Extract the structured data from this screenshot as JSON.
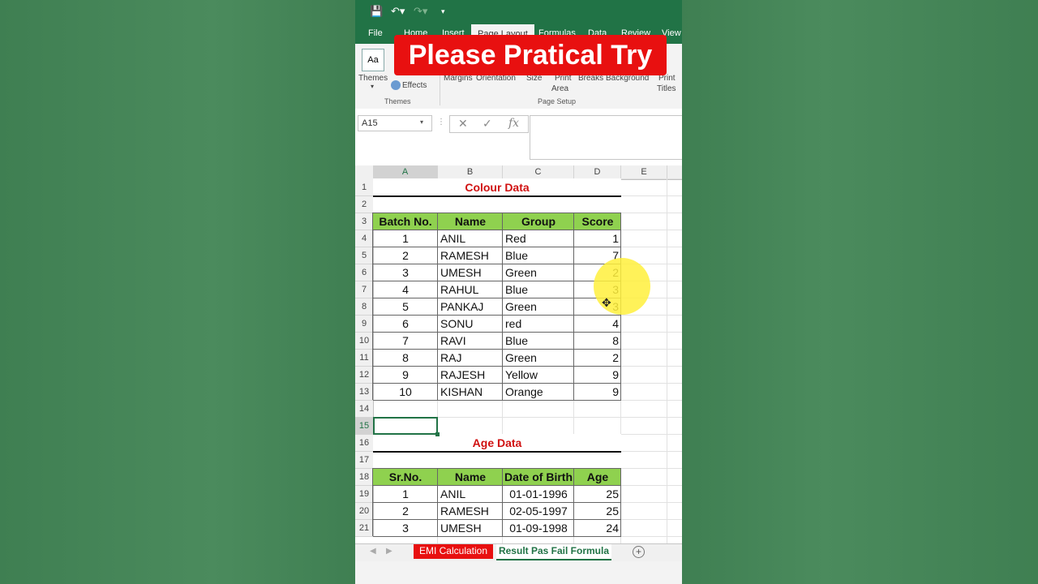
{
  "banner": "Please Pratical Try",
  "ribbon": {
    "tabs": [
      "File",
      "Home",
      "Insert",
      "Page Layout",
      "Formulas",
      "Data",
      "Review",
      "View"
    ],
    "themes": "Themes",
    "effects": "Effects",
    "margins": "Margins",
    "orientation": "Orientation",
    "size": "Size",
    "print_area_1": "Print",
    "print_area_2": "Area",
    "breaks": "Breaks",
    "background": "Background",
    "print_titles_1": "Print",
    "print_titles_2": "Titles",
    "group_themes": "Themes",
    "group_page_setup": "Page Setup"
  },
  "formula_bar": {
    "name_box": "A15",
    "fx": "fx",
    "value": ""
  },
  "columns": [
    "A",
    "B",
    "C",
    "D",
    "E"
  ],
  "rows": [
    "1",
    "2",
    "3",
    "4",
    "5",
    "6",
    "7",
    "8",
    "9",
    "10",
    "11",
    "12",
    "13",
    "14",
    "15",
    "16",
    "17",
    "18",
    "19",
    "20",
    "21"
  ],
  "colour_table": {
    "title": "Colour Data",
    "headers": [
      "Batch No.",
      "Name",
      "Group",
      "Score"
    ],
    "rows": [
      [
        "1",
        "ANIL",
        "Red",
        "1"
      ],
      [
        "2",
        "RAMESH",
        "Blue",
        "7"
      ],
      [
        "3",
        "UMESH",
        "Green",
        "2"
      ],
      [
        "4",
        "RAHUL",
        "Blue",
        "3"
      ],
      [
        "5",
        "PANKAJ",
        "Green",
        "3"
      ],
      [
        "6",
        "SONU",
        "red",
        "4"
      ],
      [
        "7",
        "RAVI",
        "Blue",
        "8"
      ],
      [
        "8",
        "RAJ",
        "Green",
        "2"
      ],
      [
        "9",
        "RAJESH",
        "Yellow",
        "9"
      ],
      [
        "10",
        "KISHAN",
        "Orange",
        "9"
      ]
    ]
  },
  "age_table": {
    "title": "Age Data",
    "headers": [
      "Sr.No.",
      "Name",
      "Date of Birth",
      "Age"
    ],
    "rows": [
      [
        "1",
        "ANIL",
        "01-01-1996",
        "25"
      ],
      [
        "2",
        "RAMESH",
        "02-05-1997",
        "25"
      ],
      [
        "3",
        "UMESH",
        "01-09-1998",
        "24"
      ]
    ]
  },
  "sheets": [
    "EMI Calculation",
    "Result Pas Fail Formula"
  ],
  "colors": {
    "excel_green": "#217346",
    "header_fill": "#8fd14f",
    "title_red": "#d01010",
    "banner_red": "#e81010"
  }
}
